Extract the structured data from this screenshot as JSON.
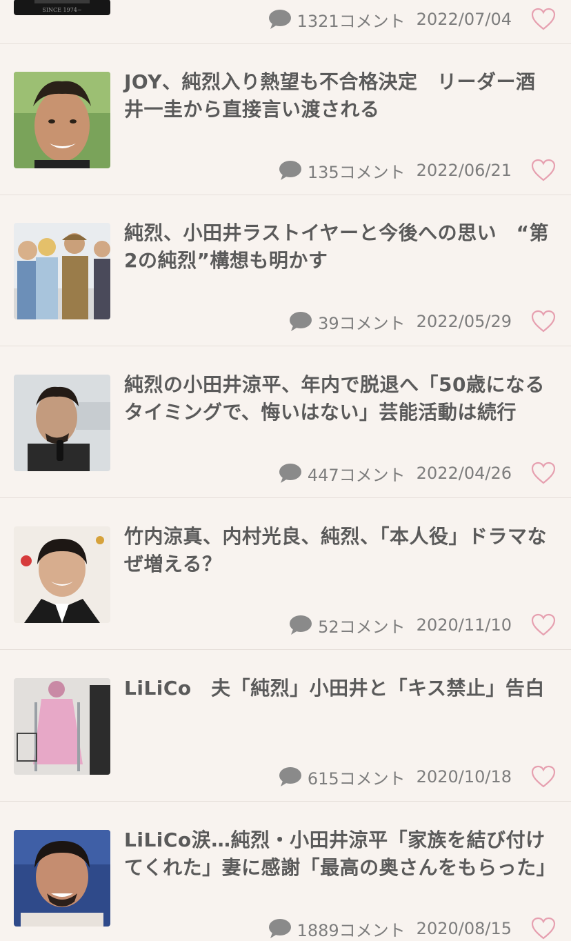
{
  "articles": [
    {
      "title": "",
      "comments": "1321コメント",
      "date": "2022/07/04",
      "thumb_caption": "SINCE 1974~"
    },
    {
      "title": "JOY、純烈入り熱望も不合格決定　リーダー酒井一圭から直接言い渡される",
      "comments": "135コメント",
      "date": "2022/06/21"
    },
    {
      "title": "純烈、小田井ラストイヤーと今後への思い　“第2の純烈”構想も明かす",
      "comments": "39コメント",
      "date": "2022/05/29"
    },
    {
      "title": "純烈の小田井涼平、年内で脱退へ「50歳になるタイミングで、悔いはない」芸能活動は続行",
      "comments": "447コメント",
      "date": "2022/04/26"
    },
    {
      "title": "竹内涼真、内村光良、純烈、「本人役」ドラマなぜ増える？",
      "comments": "52コメント",
      "date": "2020/11/10"
    },
    {
      "title": "LiLiCo　夫「純烈」小田井と「キス禁止」告白",
      "comments": "615コメント",
      "date": "2020/10/18"
    },
    {
      "title": "LiLiCo涙…純烈・小田井涼平「家族を結び付けてくれた」妻に感謝「最高の奥さんをもらった」",
      "comments": "1889コメント",
      "date": "2020/08/15"
    }
  ],
  "colors": {
    "background": "#f8f3ef",
    "divider": "#e6dfda",
    "title": "#5a5a5a",
    "meta": "#7d7d7d",
    "comment_icon": "#8a8a8a",
    "heart": "#e6a0b0"
  },
  "icons": {
    "comment": "speech-bubble-icon",
    "favorite": "heart-outline-icon"
  }
}
